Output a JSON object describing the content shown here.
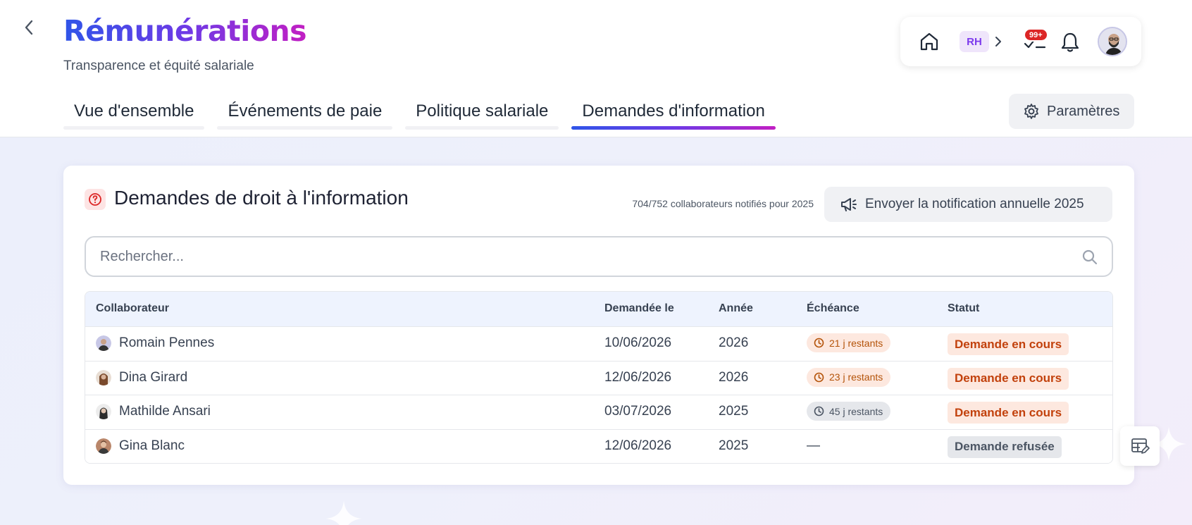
{
  "header": {
    "title": "Rémunérations",
    "subtitle": "Transparence et équité salariale"
  },
  "topbar": {
    "role_badge": "RH",
    "tasks_badge": "99+",
    "icons": [
      "home-icon",
      "chevron-right-icon",
      "tasks-check-icon",
      "bell-icon",
      "user-avatar"
    ]
  },
  "tabs": [
    {
      "label": "Vue d'ensemble",
      "active": false
    },
    {
      "label": "Événements de paie",
      "active": false
    },
    {
      "label": "Politique salariale",
      "active": false
    },
    {
      "label": "Demandes d'information",
      "active": true
    }
  ],
  "settings_button": {
    "label": "Paramètres",
    "icon": "gear-icon"
  },
  "card": {
    "title": "Demandes de droit à l'information",
    "title_icon": "question-circle-icon",
    "notified_text": "704/752 collaborateurs notifiés pour 2025",
    "send_button": {
      "label": "Envoyer la notification annuelle 2025",
      "icon": "megaphone-icon"
    },
    "search": {
      "placeholder": "Rechercher...",
      "value": ""
    },
    "table": {
      "columns": [
        "Collaborateur",
        "Demandée le",
        "Année",
        "Échéance",
        "Statut"
      ],
      "rows": [
        {
          "name": "Romain Pennes",
          "requested": "10/06/2026",
          "year": "2026",
          "deadline": "21 j restants",
          "deadline_tone": "warn",
          "status": "Demande en cours",
          "status_tone": "orange"
        },
        {
          "name": "Dina Girard",
          "requested": "12/06/2026",
          "year": "2026",
          "deadline": "23 j restants",
          "deadline_tone": "warn",
          "status": "Demande en cours",
          "status_tone": "orange"
        },
        {
          "name": "Mathilde Ansari",
          "requested": "03/07/2026",
          "year": "2025",
          "deadline": "45 j restants",
          "deadline_tone": "neutral",
          "status": "Demande en cours",
          "status_tone": "orange"
        },
        {
          "name": "Gina Blanc",
          "requested": "12/06/2026",
          "year": "2025",
          "deadline": "—",
          "deadline_tone": "none",
          "status": "Demande refusée",
          "status_tone": "grey"
        }
      ]
    }
  },
  "colors": {
    "brand_gradient_start": "#2f55e8",
    "brand_gradient_mid": "#6d3ae6",
    "brand_gradient_end": "#c21fc3",
    "badge_red": "#dc2626",
    "status_orange_text": "#c2410c",
    "status_orange_bg": "#fde8df"
  }
}
